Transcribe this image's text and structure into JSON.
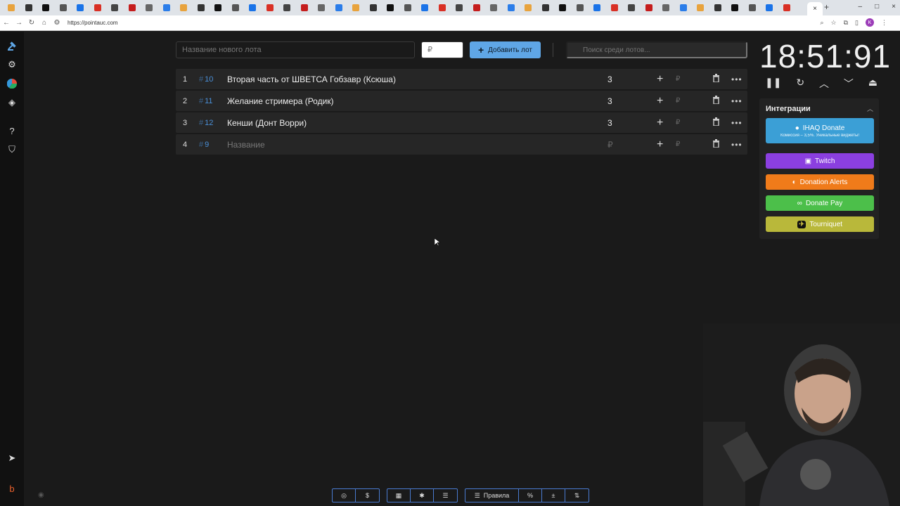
{
  "browser": {
    "url": "https://pointauc.com",
    "tab_close": "×",
    "new_tab": "+",
    "window_controls": [
      "–",
      "□",
      "×"
    ],
    "profile_initial": "K"
  },
  "header": {
    "new_lot_placeholder": "Название нового лота",
    "amount_placeholder": "₽",
    "add_button_label": "Добавить лот",
    "search_placeholder": "Поиск среди лотов..."
  },
  "lots": [
    {
      "index": "1",
      "id": "10",
      "name": "Вторая часть от ШВЕТСА Гобзавр (Ксюша)",
      "amount": "3"
    },
    {
      "index": "2",
      "id": "11",
      "name": "Желание стримера (Родик)",
      "amount": "3"
    },
    {
      "index": "3",
      "id": "12",
      "name": "Кенши (Донт Ворри)",
      "amount": "3"
    },
    {
      "index": "4",
      "id": "9",
      "name": "Название",
      "amount": "₽",
      "placeholder": true
    }
  ],
  "lot_rub_label": "₽",
  "timer": {
    "display": "18:51:91"
  },
  "integrations": {
    "title": "Интеграции",
    "buttons": [
      {
        "label": "IHAQ Donate",
        "sub": "Комиссия – 3,5%. Уникальные виджеты!",
        "color": "#3b9fd6"
      },
      {
        "label": "Twitch",
        "color": "#8b3fe0"
      },
      {
        "label": "Donation Alerts",
        "color": "#f07b1a"
      },
      {
        "label": "Donate Pay",
        "color": "#4cbf4a"
      },
      {
        "label": "Tourniquet",
        "color": "#b9b83a"
      }
    ]
  },
  "bottom_bar": {
    "rules_label": "Правила"
  }
}
